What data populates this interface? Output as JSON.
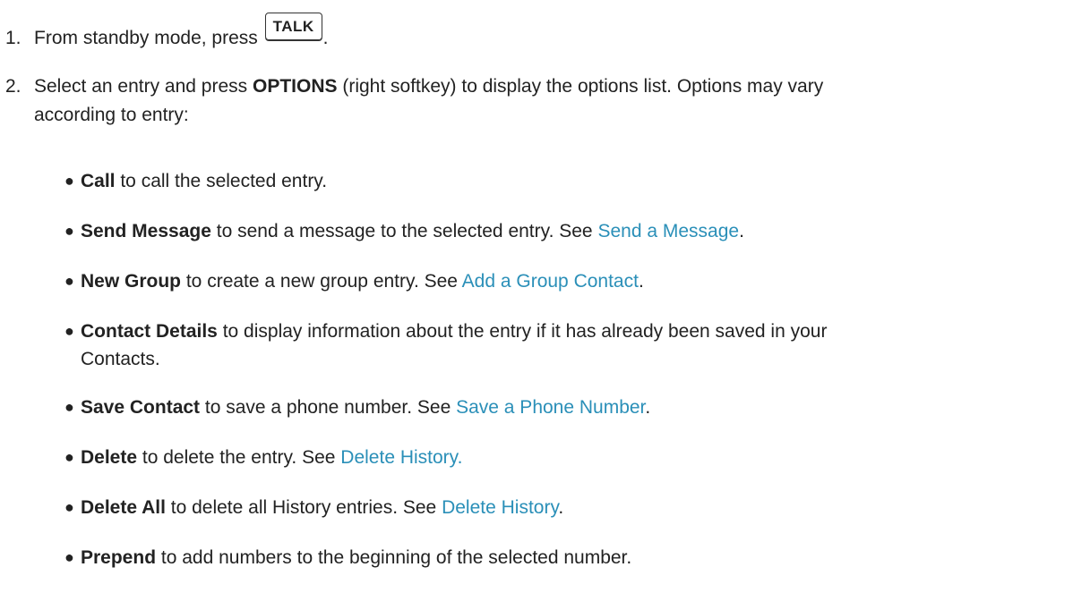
{
  "steps": [
    {
      "number": "1.",
      "text_before": "From standby mode, press",
      "key": "TALK",
      "text_after": "."
    },
    {
      "number": "2.",
      "text_1": "Select an entry and press ",
      "term": "OPTIONS",
      "text_2": " (right softkey) to display the options list. Options may vary",
      "text_3": "according to entry:"
    }
  ],
  "options": [
    {
      "term": "Call",
      "text": " to call the selected entry.",
      "link": "",
      "after": ""
    },
    {
      "term": "Send Message",
      "text": " to send a message to the selected entry. See ",
      "link": "Send a Message",
      "after": "."
    },
    {
      "term": "New Group",
      "text": " to create a new group entry. See ",
      "link": "Add a Group Contact",
      "after": "."
    },
    {
      "term": "Contact Details",
      "text": " to display information about the entry if it has already been saved in your",
      "text2": "Contacts."
    },
    {
      "term": "Save Contact",
      "text": " to save a phone number. See ",
      "link": "Save a Phone Number",
      "after": "."
    },
    {
      "term": "Delete",
      "text": " to delete the entry. See ",
      "link": "Delete History.",
      "after": ""
    },
    {
      "term": "Delete All",
      "text": " to delete all History entries. See ",
      "link": "Delete History",
      "after": "."
    },
    {
      "term": "Prepend",
      "text": " to add numbers to the beginning of the selected number.",
      "link": "",
      "after": ""
    }
  ],
  "colors": {
    "link": "#2a8fb8",
    "text": "#222222"
  }
}
